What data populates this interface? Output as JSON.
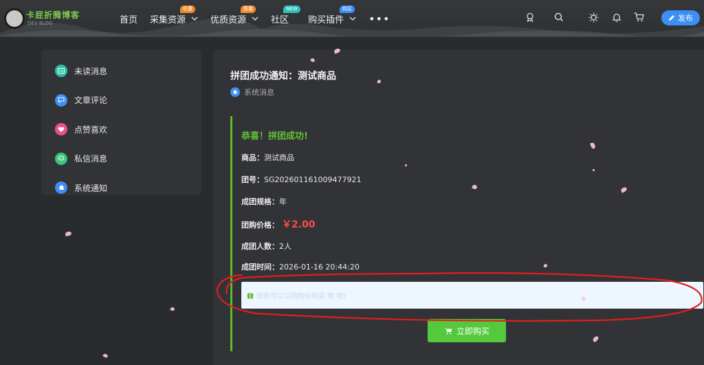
{
  "header": {
    "logo_text": "卡屁折腾博客",
    "logo_sub": "DEV BLOG",
    "nav": [
      {
        "label": "首页",
        "badge": "",
        "badge_color": "",
        "has_dropdown": false
      },
      {
        "label": "采集资源",
        "badge": "优惠",
        "badge_color": "#f08a2c",
        "has_dropdown": true
      },
      {
        "label": "优质资源",
        "badge": "质量",
        "badge_color": "#f08a2c",
        "has_dropdown": true
      },
      {
        "label": "社区",
        "badge": "NEW",
        "badge_color": "#2ec0b8",
        "has_dropdown": false
      },
      {
        "label": "购买插件",
        "badge": "购买",
        "badge_color": "#3b8ff5",
        "has_dropdown": true
      }
    ],
    "more": "•••",
    "publish_label": "发布"
  },
  "sidebar": {
    "items": [
      {
        "label": "未读消息",
        "color": "#2ec0a8",
        "icon": "message-icon"
      },
      {
        "label": "文章评论",
        "color": "#3b8ff5",
        "icon": "comment-icon"
      },
      {
        "label": "点赞喜欢",
        "color": "#f0508a",
        "icon": "heart-icon"
      },
      {
        "label": "私信消息",
        "color": "#3cc47a",
        "icon": "chat-icon"
      },
      {
        "label": "系统通知",
        "color": "#3b8ff5",
        "icon": "bell-icon"
      }
    ]
  },
  "message": {
    "title": "拼团成功通知：测试商品",
    "meta": "系统消息",
    "congrats": "恭喜！拼团成功!",
    "product_label": "商品：",
    "product_value": "测试商品",
    "group_no_label": "团号：",
    "group_no_value": "SG202601161009477921",
    "spec_label": "成团规格：",
    "spec_value": "年",
    "price_label": "团购价格：",
    "price_value": "￥2.00",
    "count_label": "成团人数：",
    "count_value": "2人",
    "time_label": "成团时间：",
    "time_value": "2026-01-16 20:44:20",
    "notice": "现在可以以团购价购买 哦 哈!",
    "buy_label": "立即购买"
  },
  "colors": {
    "accent": "#3b8ff5",
    "success": "#55c93d",
    "price": "#ff4a4a",
    "annotation": "#e0201b"
  }
}
